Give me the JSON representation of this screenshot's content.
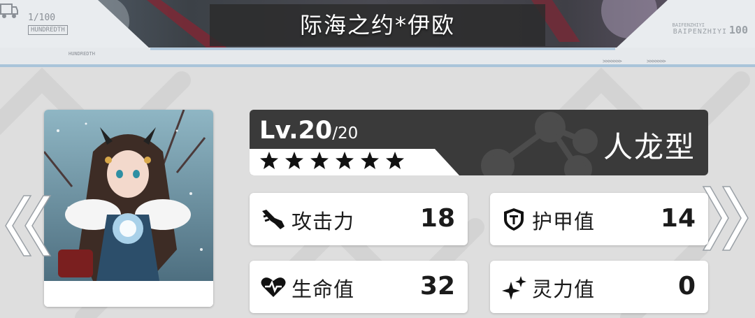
{
  "header": {
    "title": "际海之约*伊欧",
    "left_fraction": "1/100",
    "left_badge": "HUNDREDTH",
    "left_small": "HUNDREDTH",
    "right_small": "BAIFENZHIYI",
    "right_big": "BAIPENZHIYI",
    "right_num": "100",
    "chevrons": ">>>>>>>"
  },
  "character": {
    "level": "Lv.20",
    "max_level": "/20",
    "stars": 6,
    "type": "人龙型"
  },
  "stats": [
    {
      "label": "攻击力",
      "value": "18",
      "icon": "attack-icon"
    },
    {
      "label": "护甲值",
      "value": "14",
      "icon": "armor-shield-icon"
    },
    {
      "label": "生命值",
      "value": "32",
      "icon": "heart-icon"
    },
    {
      "label": "灵力值",
      "value": "0",
      "icon": "sparkle-icon"
    }
  ],
  "colors": {
    "background": "#dedede",
    "panel_dark": "#3a3a3a",
    "card": "#ffffff",
    "text": "#1b1b1b",
    "header_accent": "#a9c4da"
  }
}
